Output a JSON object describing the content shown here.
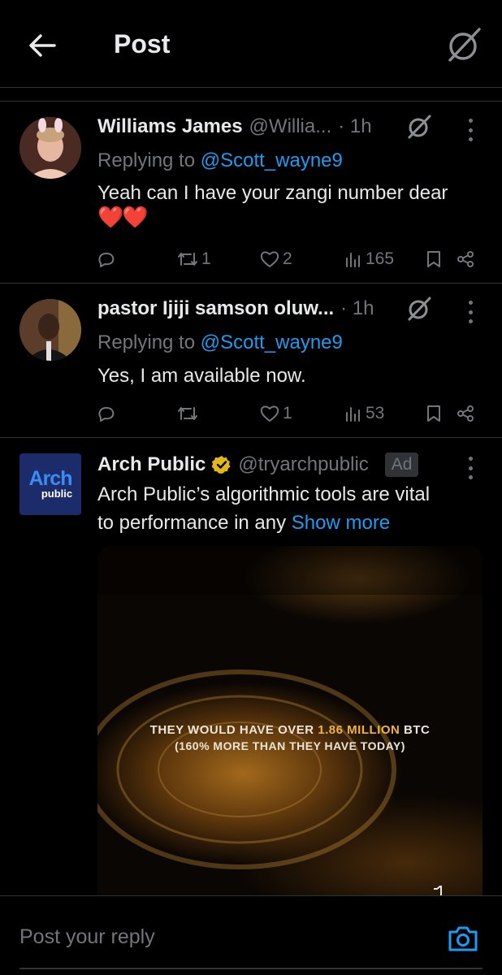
{
  "header": {
    "title": "Post",
    "back_icon": "arrow-left-icon",
    "grok_icon": "grok-icon"
  },
  "replies": [
    {
      "name": "Williams James",
      "handle": "@Willia...",
      "time": "· 1h",
      "replying_prefix": "Replying to ",
      "replying_to": "@Scott_wayne9",
      "text": "Yeah can I have your zangi number dear",
      "emoji": "❤️❤️",
      "counts": {
        "replies": "",
        "reposts": "1",
        "likes": "2",
        "views": "165"
      }
    },
    {
      "name": "pastor Ijiji samson oluw...",
      "handle": "",
      "time": "· 1h",
      "replying_prefix": "Replying to ",
      "replying_to": "@Scott_wayne9",
      "text": "Yes, I am available now.",
      "counts": {
        "replies": "",
        "reposts": "",
        "likes": "1",
        "views": "53"
      }
    }
  ],
  "ad": {
    "name": "Arch Public",
    "handle": "@tryarchpublic",
    "badge": "Ad",
    "logo_line1": "Arch",
    "logo_line2": "public",
    "text_line1": "Arch Public’s algorithmic tools are vital",
    "text_line2": "to performance in any ",
    "show_more": "Show more",
    "media_caption_pre": "THEY WOULD HAVE OVER ",
    "media_caption_highlight": "1.86 MILLION",
    "media_caption_post": " BTC",
    "media_caption_line2": "(160% MORE THAN THEY HAVE TODAY)"
  },
  "compose": {
    "placeholder": "Post your reply",
    "camera_icon": "camera-icon"
  },
  "colors": {
    "background": "#000000",
    "text": "#e7e9ea",
    "muted": "#71767b",
    "accent": "#1d9bf0",
    "divider": "#2f3336",
    "verified": "#e2b719"
  }
}
